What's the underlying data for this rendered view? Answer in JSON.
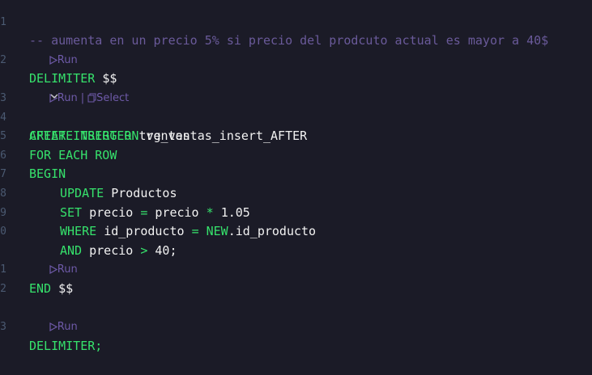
{
  "comment_line": "-- aumenta en un precio 5% si precio del prodcuto actual es mayor a 40$",
  "codelens": {
    "run": "Run",
    "separator": "|",
    "select": "Select"
  },
  "line_numbers": [
    "1",
    "",
    "2",
    "",
    "3",
    "4",
    "5",
    "6",
    "7",
    "8",
    "9",
    "0",
    "",
    "1",
    "2",
    "",
    "3"
  ],
  "code": {
    "delimiter_kw": "DELIMITER",
    "delimiter_sym": "$$",
    "create_kw": "CREATE TRIGGER",
    "trigger_name": "trg_ventas_insert_AFTER",
    "after_kw": "AFTER INSERT ON",
    "table": "ventas",
    "for_each": "FOR EACH ROW",
    "begin": "BEGIN",
    "update_kw": "UPDATE",
    "update_table": "Productos",
    "set_kw": "SET",
    "set_expr_col": "precio",
    "equals": "=",
    "set_expr_ref": "precio",
    "multiply": "*",
    "factor": "1.05",
    "where_kw": "WHERE",
    "where_col": "id_producto",
    "new_kw": "NEW",
    "new_col": ".id_producto",
    "and_kw": "AND",
    "and_col": "precio",
    "gt": ">",
    "threshold": "40;",
    "end_kw": "END",
    "end_sym": "$$",
    "final_delimiter": "DELIMITER;"
  },
  "colors": {
    "background": "#1b1b27",
    "keyword": "#36e26c",
    "identifier": "#f2f2f2",
    "comment": "#6a5a9a",
    "codelens": "#6e5aa8"
  }
}
